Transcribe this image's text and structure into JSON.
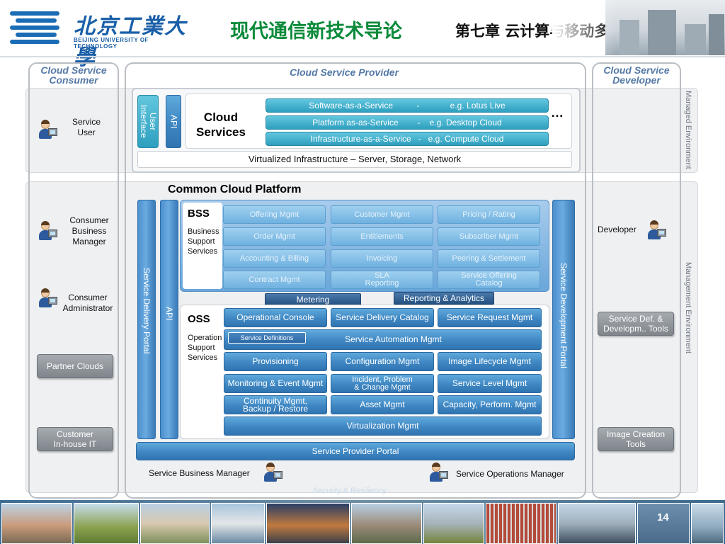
{
  "header": {
    "logo_cn": "北京工業大學",
    "logo_en": "BEIJING UNIVERSITY OF TECHNOLOGY",
    "title_main": "现代通信新技术导论",
    "title_sub": "第七章 云计算与移动多媒体广播"
  },
  "consumer": {
    "title": "Cloud Service Consumer",
    "service_user": "Service\nUser",
    "business_manager": "Consumer\nBusiness\nManager",
    "administrator": "Consumer\nAdministrator",
    "partner_clouds": "Partner Clouds",
    "inhouse_it": "Customer\nIn-house IT"
  },
  "provider": {
    "title": "Cloud Service Provider",
    "user_interface": "User Interface",
    "api": "API",
    "cloud_services": "Cloud\nServices",
    "saas": "Software-as-a-Service          -             e.g. Lotus Live",
    "paas": "Platform as-as-Service        -    e.g. Desktop Cloud",
    "iaas": "Infrastructure-as-a-Service   -   e.g. Compute Cloud",
    "ellipsis": "…",
    "virtualized": "Virtualized Infrastructure – Server, Storage, Network",
    "common_platform": "Common Cloud Platform",
    "service_delivery_portal": "Service  Delivery  Portal",
    "api2": "API",
    "service_development_portal": "Service  Development Portal",
    "bss": {
      "title": "BSS",
      "desc": "Business\nSupport\nServices",
      "items": [
        "Offering Mgmt",
        "Customer Mgmt",
        "Pricing / Rating",
        "Order Mgmt",
        "Entitlements",
        "Subscriber  Mgmt",
        "Accounting & Billing",
        "Invoicing",
        "Peering & Settlement",
        "Contract Mgmt",
        "SLA\nReporting",
        "Service Offering\nCatalog"
      ]
    },
    "metering": "Metering",
    "reporting": "Reporting & Analytics",
    "oss": {
      "title": "OSS",
      "desc": "Operation\nSupport\nServices",
      "operational_console": "Operational Console",
      "service_delivery_catalog": "Service Delivery Catalog",
      "service_request_mgmt": "Service Request  Mgmt",
      "service_definitions": "Service Definitions",
      "service_automation": "Service Automation Mgmt",
      "provisioning": "Provisioning",
      "configuration_mgmt": "Configuration Mgmt",
      "image_lifecycle": "Image Lifecycle Mgmt",
      "monitoring": "Monitoring & Event Mgmt",
      "incident": "Incident, Problem\n& Change Mgmt",
      "service_level": "Service Level Mgmt",
      "continuity": "Continuity Mgmt,\nBackup / Restore",
      "asset_mgmt": "Asset Mgmt",
      "capacity": "Capacity, Perform. Mgmt",
      "virtualization": "Virtualization Mgmt"
    },
    "service_provider_portal": "Service Provider Portal",
    "service_business_manager": "Service Business Manager",
    "service_operations_manager": "Service Operations Manager",
    "security": "Security & Resiliency"
  },
  "developer": {
    "title": "Cloud Service Developer",
    "developer": "Developer",
    "service_def_tools": "Service Def. &\nDevelopm.. Tools",
    "image_creation_tools": "Image Creation\nTools"
  },
  "bands": {
    "managed_env": "Managed  Environment",
    "management_env": "Management  Environment"
  },
  "footer": {
    "page_number": "14"
  },
  "colors": {
    "accent_blue": "#3f87c3",
    "title_green": "#0a8a3a",
    "panel_title": "#5579a6",
    "cyan": "#2e9fbf"
  }
}
